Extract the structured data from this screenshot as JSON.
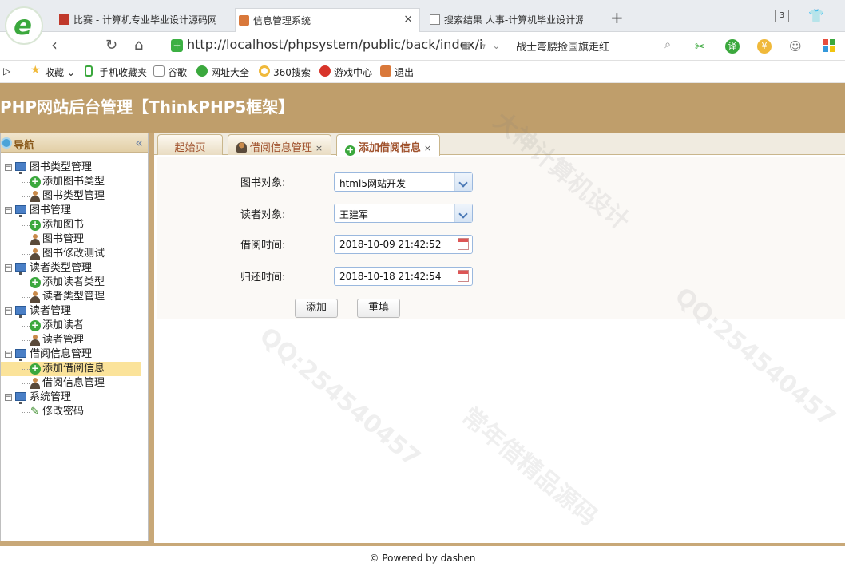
{
  "browser": {
    "tabs": [
      {
        "title": "比赛 - 计算机专业毕业设计源码网",
        "active": false
      },
      {
        "title": "信息管理系统",
        "active": true
      },
      {
        "title": "搜索结果 人事-计算机毕业设计源",
        "active": false
      }
    ],
    "new_tab": "+",
    "window_count": "3",
    "url": "http://localhost/phpsystem/public/back/index/i",
    "search_text": "战士弯腰捡国旗走红",
    "bookmarks": [
      "收藏",
      "手机收藏夹",
      "谷歌",
      "网址大全",
      "360搜索",
      "游戏中心",
      "退出"
    ]
  },
  "app": {
    "title": "PHP网站后台管理【ThinkPHP5框架】"
  },
  "nav": {
    "title": "导航",
    "collapse": "«",
    "groups": [
      {
        "label": "图书类型管理",
        "items": [
          {
            "label": "添加图书类型",
            "icon": "add"
          },
          {
            "label": "图书类型管理",
            "icon": "person"
          }
        ]
      },
      {
        "label": "图书管理",
        "items": [
          {
            "label": "添加图书",
            "icon": "add"
          },
          {
            "label": "图书管理",
            "icon": "person"
          },
          {
            "label": "图书修改测试",
            "icon": "person"
          }
        ]
      },
      {
        "label": "读者类型管理",
        "items": [
          {
            "label": "添加读者类型",
            "icon": "add"
          },
          {
            "label": "读者类型管理",
            "icon": "person"
          }
        ]
      },
      {
        "label": "读者管理",
        "items": [
          {
            "label": "添加读者",
            "icon": "add"
          },
          {
            "label": "读者管理",
            "icon": "person"
          }
        ]
      },
      {
        "label": "借阅信息管理",
        "items": [
          {
            "label": "添加借阅信息",
            "icon": "add",
            "selected": true
          },
          {
            "label": "借阅信息管理",
            "icon": "person"
          }
        ]
      },
      {
        "label": "系统管理",
        "items": [
          {
            "label": "修改密码",
            "icon": "pencil"
          }
        ]
      }
    ]
  },
  "page_tabs": [
    {
      "label": "起始页",
      "closable": false
    },
    {
      "label": "借阅信息管理",
      "closable": true
    },
    {
      "label": "添加借阅信息",
      "closable": true,
      "active": true
    }
  ],
  "form": {
    "book_label": "图书对象:",
    "book_value": "html5网站开发",
    "reader_label": "读者对象:",
    "reader_value": "王建军",
    "borrow_label": "借阅时间:",
    "borrow_value": "2018-10-09 21:42:52",
    "return_label": "归还时间:",
    "return_value": "2018-10-18 21:42:54",
    "submit_label": "添加",
    "reset_label": "重填"
  },
  "footer": "© Powered by dashen",
  "colors": {
    "header_bg": "#bf9e6b",
    "tab_text": "#a0522d",
    "selected_bg": "#fbe39a"
  }
}
